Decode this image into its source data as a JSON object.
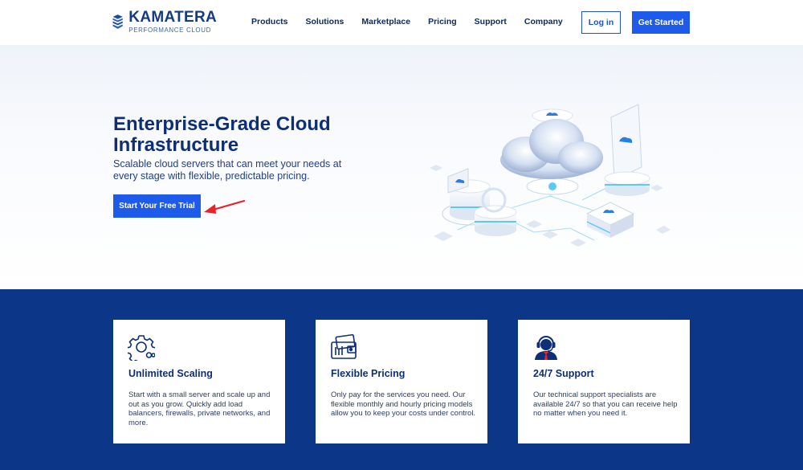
{
  "header": {
    "logo": {
      "name": "KAMATERA",
      "tagline": "PERFORMANCE CLOUD"
    },
    "nav": [
      "Products",
      "Solutions",
      "Marketplace",
      "Pricing",
      "Support",
      "Company"
    ],
    "login_label": "Log in",
    "get_started_label": "Get Started"
  },
  "hero": {
    "title": "Enterprise-Grade Cloud Infrastructure",
    "subtitle": "Scalable cloud servers that can meet your needs at every stage with flexible, predictable pricing.",
    "cta_label": "Start Your Free Trial"
  },
  "features": [
    {
      "icon": "gear-scaling-icon",
      "title": "Unlimited Scaling",
      "text": "Start with a small server and scale up and out as you grow. Quickly add load balancers, firewalls, private networks, and more."
    },
    {
      "icon": "wallet-icon",
      "title": "Flexible Pricing",
      "text": "Only pay for the services you need. Our flexible monthly and hourly pricing models allow you to keep your costs under control."
    },
    {
      "icon": "support-agent-icon",
      "title": "24/7 Support",
      "text": "Our technical support specialists are available 24/7 so that you can receive help no matter when you need it."
    }
  ],
  "colors": {
    "primary_button": "#1f5bea",
    "band_background": "#0c3789",
    "heading": "#0e2f76",
    "annotation_arrow": "#e8232a"
  }
}
